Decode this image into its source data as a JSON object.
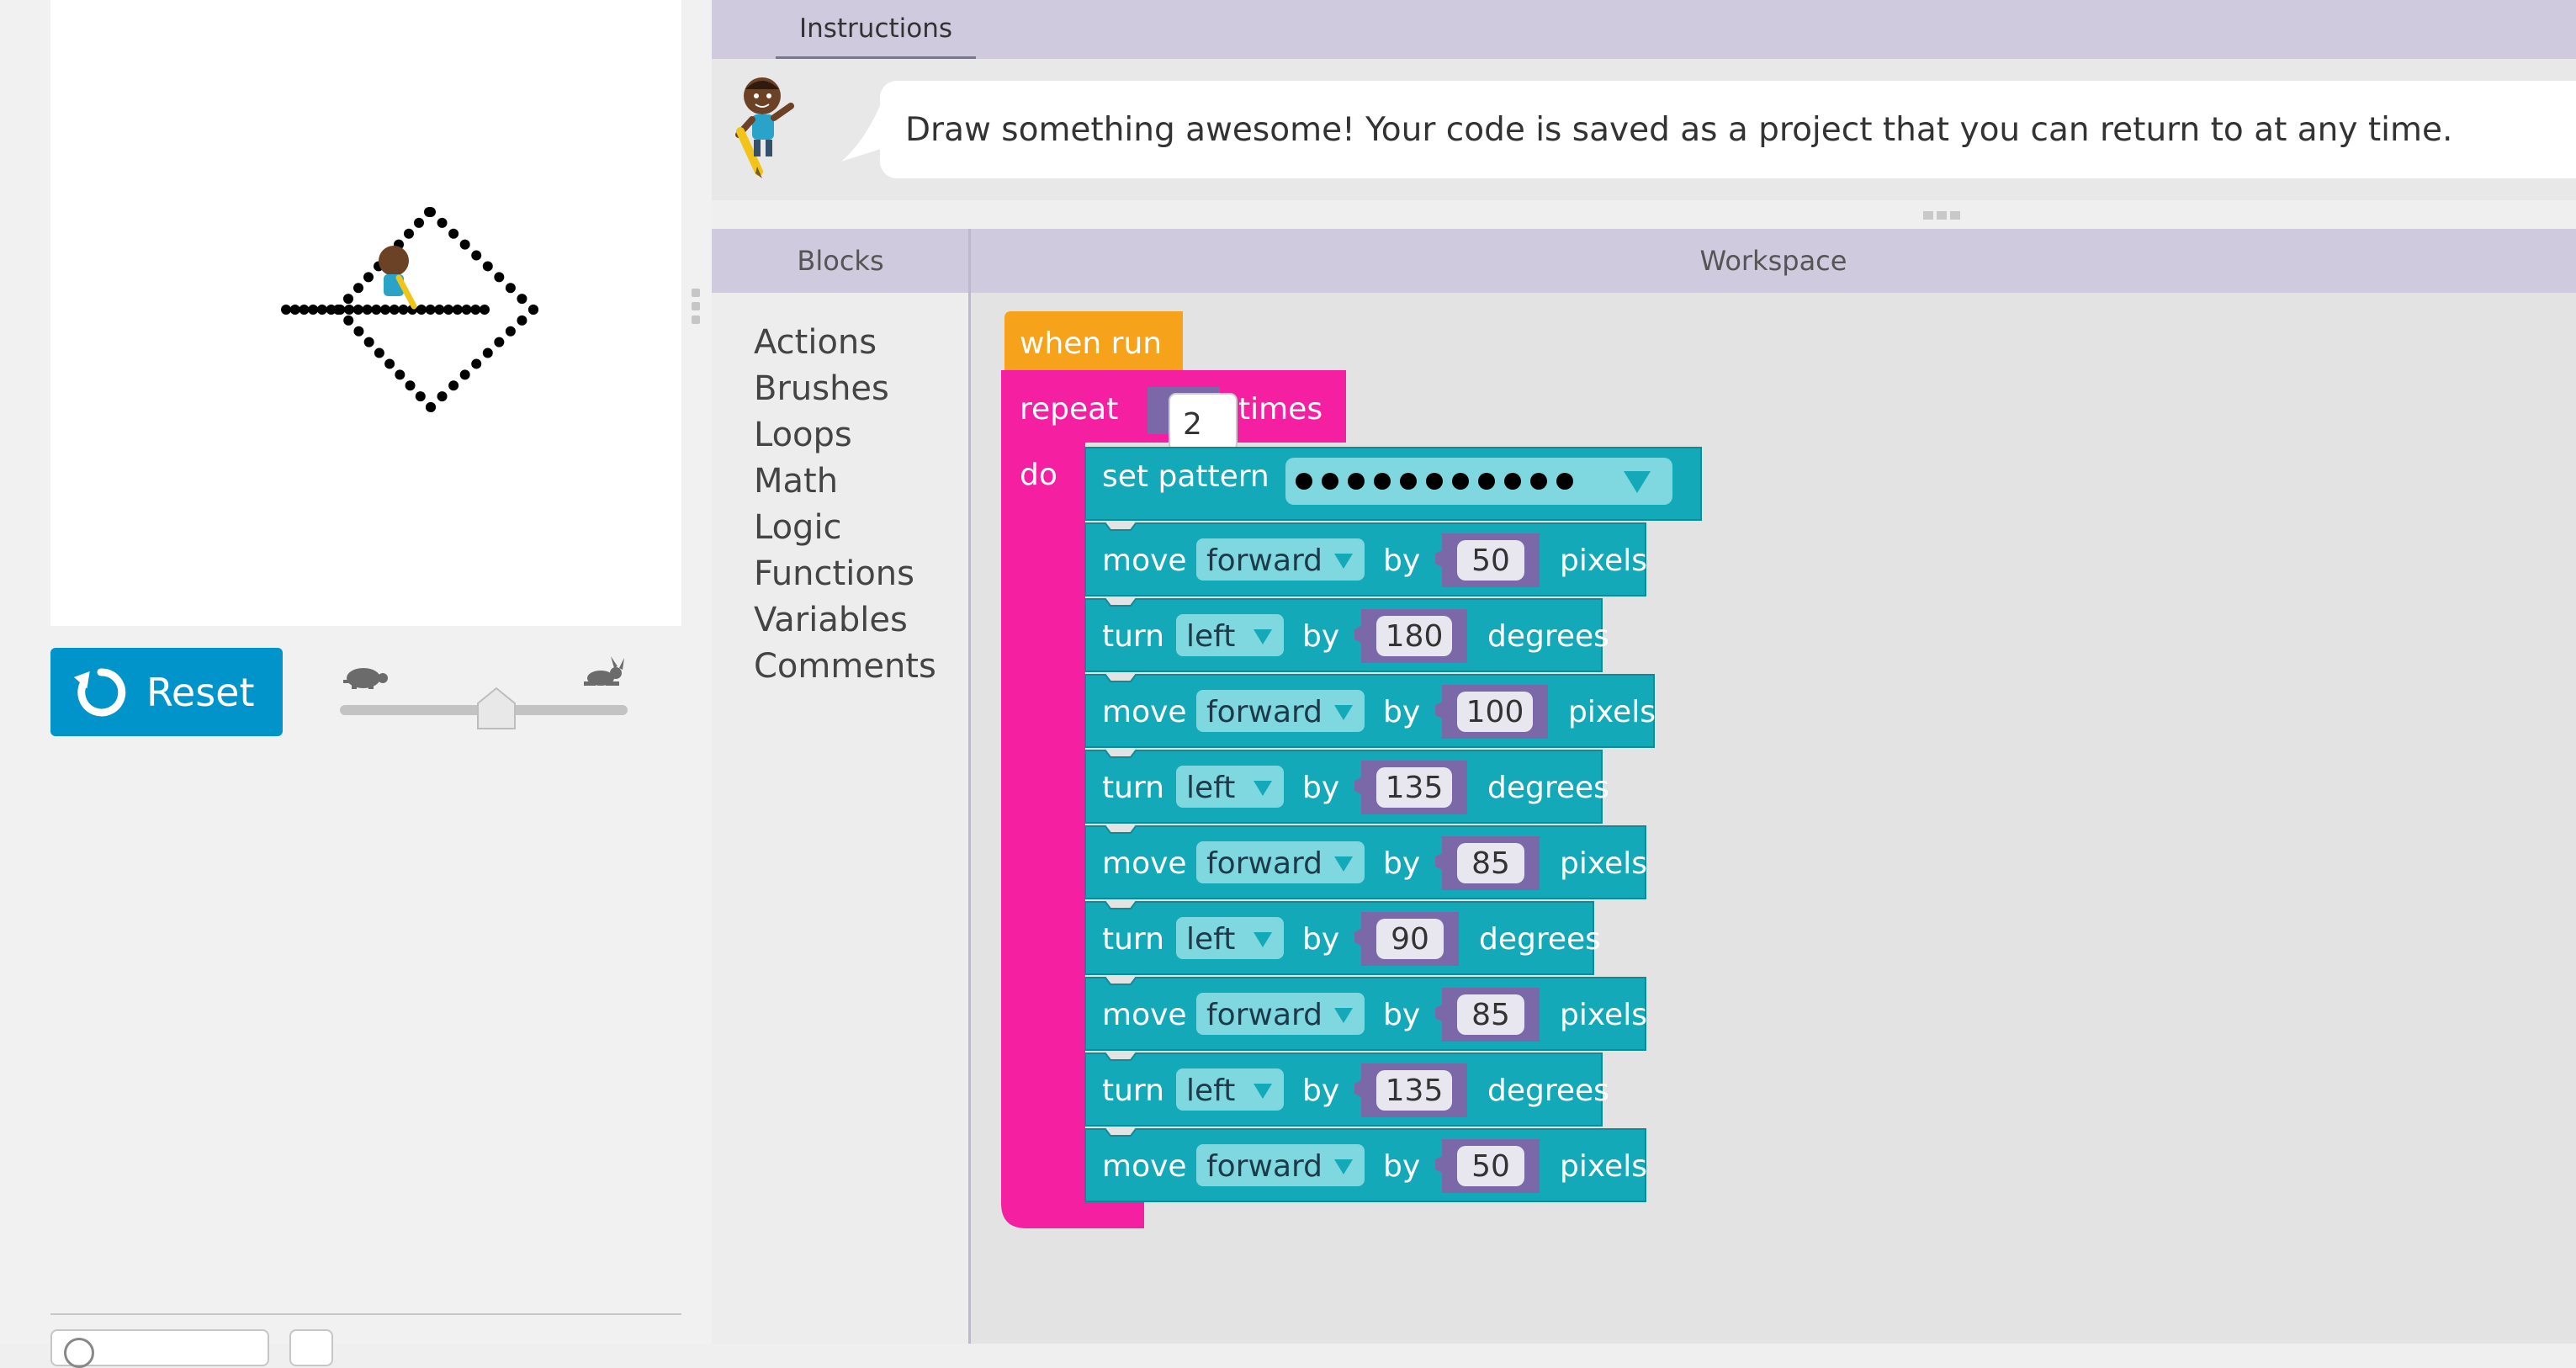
{
  "instructions": {
    "tab_label": "Instructions",
    "text": "Draw something awesome! Your code is saved as a project that you can return to at any time."
  },
  "controls": {
    "reset_label": "Reset"
  },
  "panes": {
    "blocks_title": "Blocks",
    "workspace_title": "Workspace"
  },
  "toolbox": {
    "categories": [
      "Actions",
      "Brushes",
      "Loops",
      "Math",
      "Logic",
      "Functions",
      "Variables",
      "Comments"
    ]
  },
  "program": {
    "hat_label": "when run",
    "repeat": {
      "label": "repeat",
      "count": "2",
      "times_label": "times",
      "do_label": "do"
    },
    "set_pattern": {
      "label": "set pattern",
      "pattern": "●●●●●●●●●●●"
    },
    "statements": [
      {
        "kind": "move",
        "verb": "move",
        "dir": "forward",
        "by": "by",
        "value": "50",
        "unit": "pixels"
      },
      {
        "kind": "turn",
        "verb": "turn",
        "dir": "left",
        "by": "by",
        "value": "180",
        "unit": "degrees"
      },
      {
        "kind": "move",
        "verb": "move",
        "dir": "forward",
        "by": "by",
        "value": "100",
        "unit": "pixels"
      },
      {
        "kind": "turn",
        "verb": "turn",
        "dir": "left",
        "by": "by",
        "value": "135",
        "unit": "degrees"
      },
      {
        "kind": "move",
        "verb": "move",
        "dir": "forward",
        "by": "by",
        "value": "85",
        "unit": "pixels"
      },
      {
        "kind": "turn",
        "verb": "turn",
        "dir": "left",
        "by": "by",
        "value": "90",
        "unit": "degrees"
      },
      {
        "kind": "move",
        "verb": "move",
        "dir": "forward",
        "by": "by",
        "value": "85",
        "unit": "pixels"
      },
      {
        "kind": "turn",
        "verb": "turn",
        "dir": "left",
        "by": "by",
        "value": "135",
        "unit": "degrees"
      },
      {
        "kind": "move",
        "verb": "move",
        "dir": "forward",
        "by": "by",
        "value": "50",
        "unit": "pixels"
      }
    ]
  },
  "colors": {
    "hat": "#f7a21b",
    "loop": "#f51fa1",
    "action": "#13a9b9",
    "action_dark": "#0f8b98",
    "dropdown": "#7fd7df",
    "math": "#7a68a8",
    "reset": "#0094ca"
  }
}
